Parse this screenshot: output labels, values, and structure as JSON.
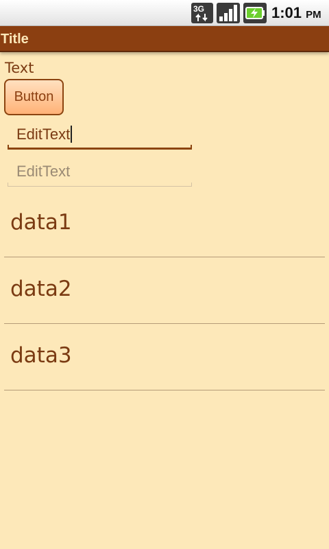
{
  "status_bar": {
    "time": "1:01",
    "ampm": "PM",
    "icons": [
      "3g-data-icon",
      "signal-strength-icon",
      "battery-charging-icon"
    ]
  },
  "app": {
    "title": "Title"
  },
  "content": {
    "label": "Text",
    "button_label": "Button",
    "edit_fields": [
      {
        "value": "EditText",
        "focused": true
      },
      {
        "placeholder": "EditText",
        "focused": false
      }
    ],
    "list_items": [
      "data1",
      "data2",
      "data3"
    ]
  },
  "colors": {
    "background": "#fde8b9",
    "title_bar": "#8b3f11",
    "text": "#7a3a12"
  }
}
